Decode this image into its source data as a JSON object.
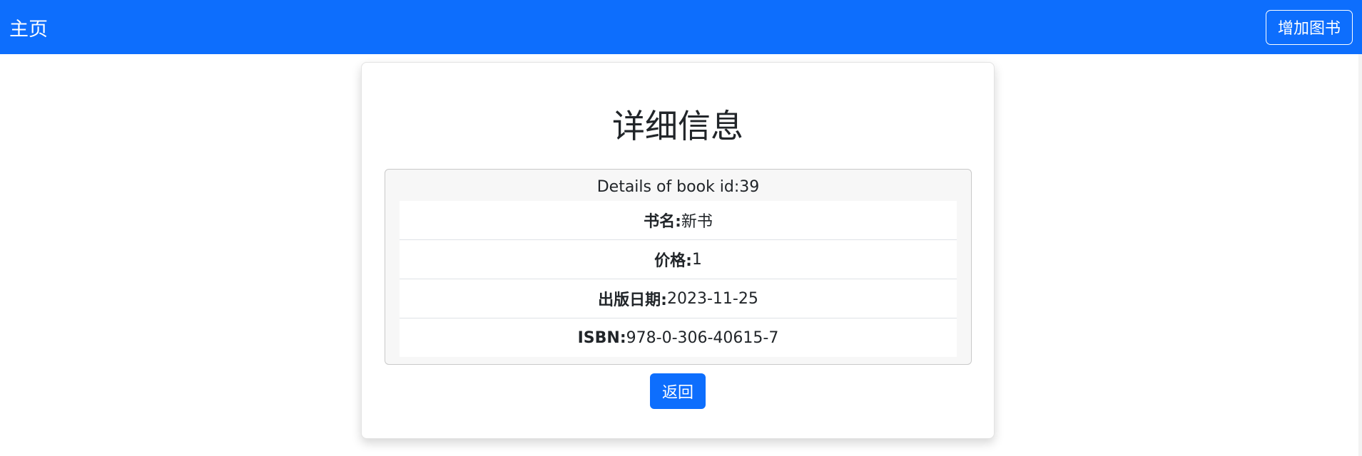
{
  "navbar": {
    "brand": "主页",
    "add_book_label": "增加图书",
    "color": "#0d6efd"
  },
  "card": {
    "title": "详细信息",
    "panel_header": "Details of book id:39",
    "fields": [
      {
        "label": "书名:",
        "value": "新书"
      },
      {
        "label": "价格:",
        "value": "1"
      },
      {
        "label": "出版日期:",
        "value": "2023-11-25"
      },
      {
        "label": "ISBN:",
        "value": "978-0-306-40615-7"
      }
    ],
    "back_label": "返回"
  }
}
